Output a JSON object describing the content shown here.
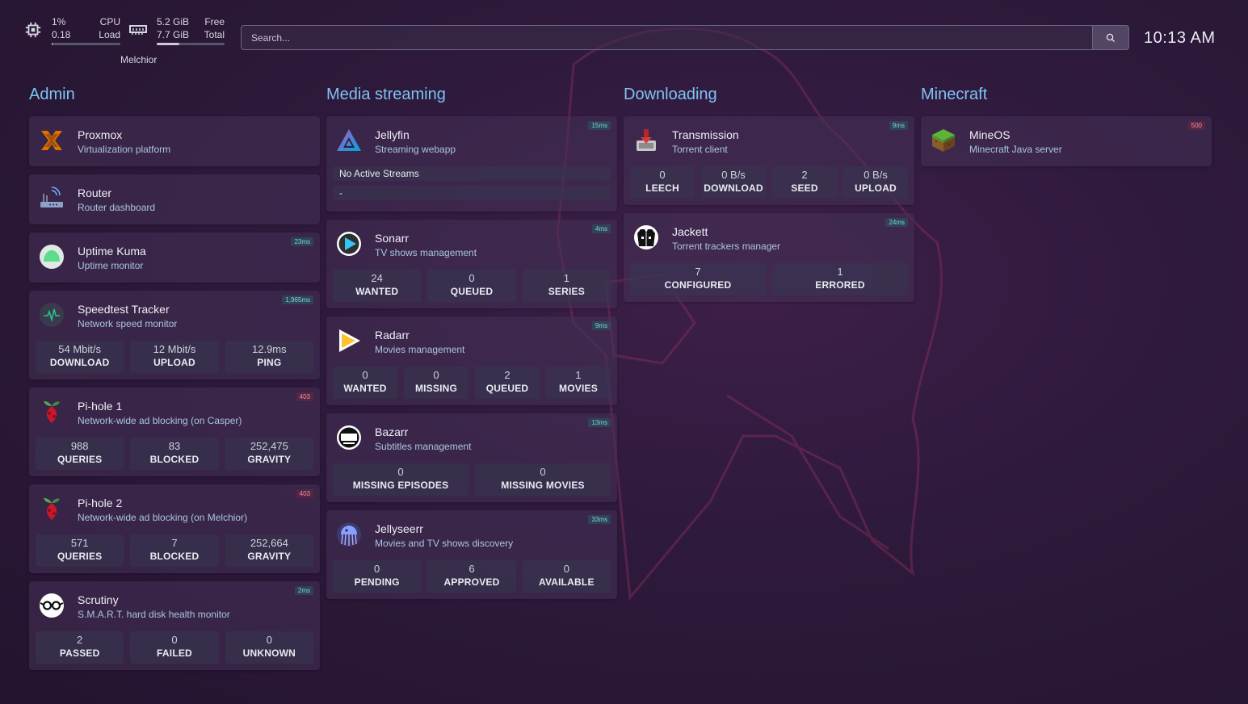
{
  "header": {
    "cpu": {
      "usage": "1%",
      "load": "0.18",
      "usage_label": "CPU",
      "load_label": "Load",
      "fraction": 0.01
    },
    "memory": {
      "free": "5.2 GiB",
      "total": "7.7 GiB",
      "free_label": "Free",
      "total_label": "Total",
      "fraction": 0.33
    },
    "host": "Melchior",
    "search_placeholder": "Search...",
    "clock": "10:13 AM"
  },
  "groups": [
    {
      "title": "Admin",
      "services": [
        {
          "name": "Proxmox",
          "description": "Virtualization platform",
          "icon": "proxmox-icon"
        },
        {
          "name": "Router",
          "description": "Router dashboard",
          "icon": "router-icon"
        },
        {
          "name": "Uptime Kuma",
          "description": "Uptime monitor",
          "icon": "uptime-kuma-icon",
          "ping": "23ms"
        },
        {
          "name": "Speedtest Tracker",
          "description": "Network speed monitor",
          "icon": "speedtest-icon",
          "ping": "1,965ms",
          "stats": [
            {
              "value": "54 Mbit/s",
              "label": "DOWNLOAD"
            },
            {
              "value": "12 Mbit/s",
              "label": "UPLOAD"
            },
            {
              "value": "12.9ms",
              "label": "PING"
            }
          ]
        },
        {
          "name": "Pi-hole 1",
          "description": "Network-wide ad blocking (on Casper)",
          "icon": "pihole-icon",
          "ping": "403",
          "stats": [
            {
              "value": "988",
              "label": "QUERIES"
            },
            {
              "value": "83",
              "label": "BLOCKED"
            },
            {
              "value": "252,475",
              "label": "GRAVITY"
            }
          ]
        },
        {
          "name": "Pi-hole 2",
          "description": "Network-wide ad blocking (on Melchior)",
          "icon": "pihole-icon",
          "ping": "403",
          "stats": [
            {
              "value": "571",
              "label": "QUERIES"
            },
            {
              "value": "7",
              "label": "BLOCKED"
            },
            {
              "value": "252,664",
              "label": "GRAVITY"
            }
          ]
        },
        {
          "name": "Scrutiny",
          "description": "S.M.A.R.T. hard disk health monitor",
          "icon": "scrutiny-icon",
          "ping": "2ms",
          "stats": [
            {
              "value": "2",
              "label": "PASSED"
            },
            {
              "value": "0",
              "label": "FAILED"
            },
            {
              "value": "0",
              "label": "UNKNOWN"
            }
          ]
        }
      ]
    },
    {
      "title": "Media streaming",
      "services": [
        {
          "name": "Jellyfin",
          "description": "Streaming webapp",
          "icon": "jellyfin-icon",
          "ping": "15ms",
          "streams": [
            "No Active Streams",
            "-"
          ]
        },
        {
          "name": "Sonarr",
          "description": "TV shows management",
          "icon": "sonarr-icon",
          "ping": "4ms",
          "stats": [
            {
              "value": "24",
              "label": "WANTED"
            },
            {
              "value": "0",
              "label": "QUEUED"
            },
            {
              "value": "1",
              "label": "SERIES"
            }
          ]
        },
        {
          "name": "Radarr",
          "description": "Movies management",
          "icon": "radarr-icon",
          "ping": "9ms",
          "stats": [
            {
              "value": "0",
              "label": "WANTED"
            },
            {
              "value": "0",
              "label": "MISSING"
            },
            {
              "value": "2",
              "label": "QUEUED"
            },
            {
              "value": "1",
              "label": "MOVIES"
            }
          ]
        },
        {
          "name": "Bazarr",
          "description": "Subtitles management",
          "icon": "bazarr-icon",
          "ping": "13ms",
          "stats": [
            {
              "value": "0",
              "label": "MISSING EPISODES"
            },
            {
              "value": "0",
              "label": "MISSING MOVIES"
            }
          ]
        },
        {
          "name": "Jellyseerr",
          "description": "Movies and TV shows discovery",
          "icon": "jellyseerr-icon",
          "ping": "33ms",
          "stats": [
            {
              "value": "0",
              "label": "PENDING"
            },
            {
              "value": "6",
              "label": "APPROVED"
            },
            {
              "value": "0",
              "label": "AVAILABLE"
            }
          ]
        }
      ]
    },
    {
      "title": "Downloading",
      "services": [
        {
          "name": "Transmission",
          "description": "Torrent client",
          "icon": "transmission-icon",
          "ping": "9ms",
          "stats": [
            {
              "value": "0",
              "label": "LEECH"
            },
            {
              "value": "0 B/s",
              "label": "DOWNLOAD"
            },
            {
              "value": "2",
              "label": "SEED"
            },
            {
              "value": "0 B/s",
              "label": "UPLOAD"
            }
          ]
        },
        {
          "name": "Jackett",
          "description": "Torrent trackers manager",
          "icon": "jackett-icon",
          "ping": "24ms",
          "stats": [
            {
              "value": "7",
              "label": "CONFIGURED"
            },
            {
              "value": "1",
              "label": "ERRORED"
            }
          ]
        }
      ]
    },
    {
      "title": "Minecraft",
      "services": [
        {
          "name": "MineOS",
          "description": "Minecraft Java server",
          "icon": "minecraft-icon",
          "ping": "500",
          "ping_error": true
        }
      ]
    }
  ]
}
